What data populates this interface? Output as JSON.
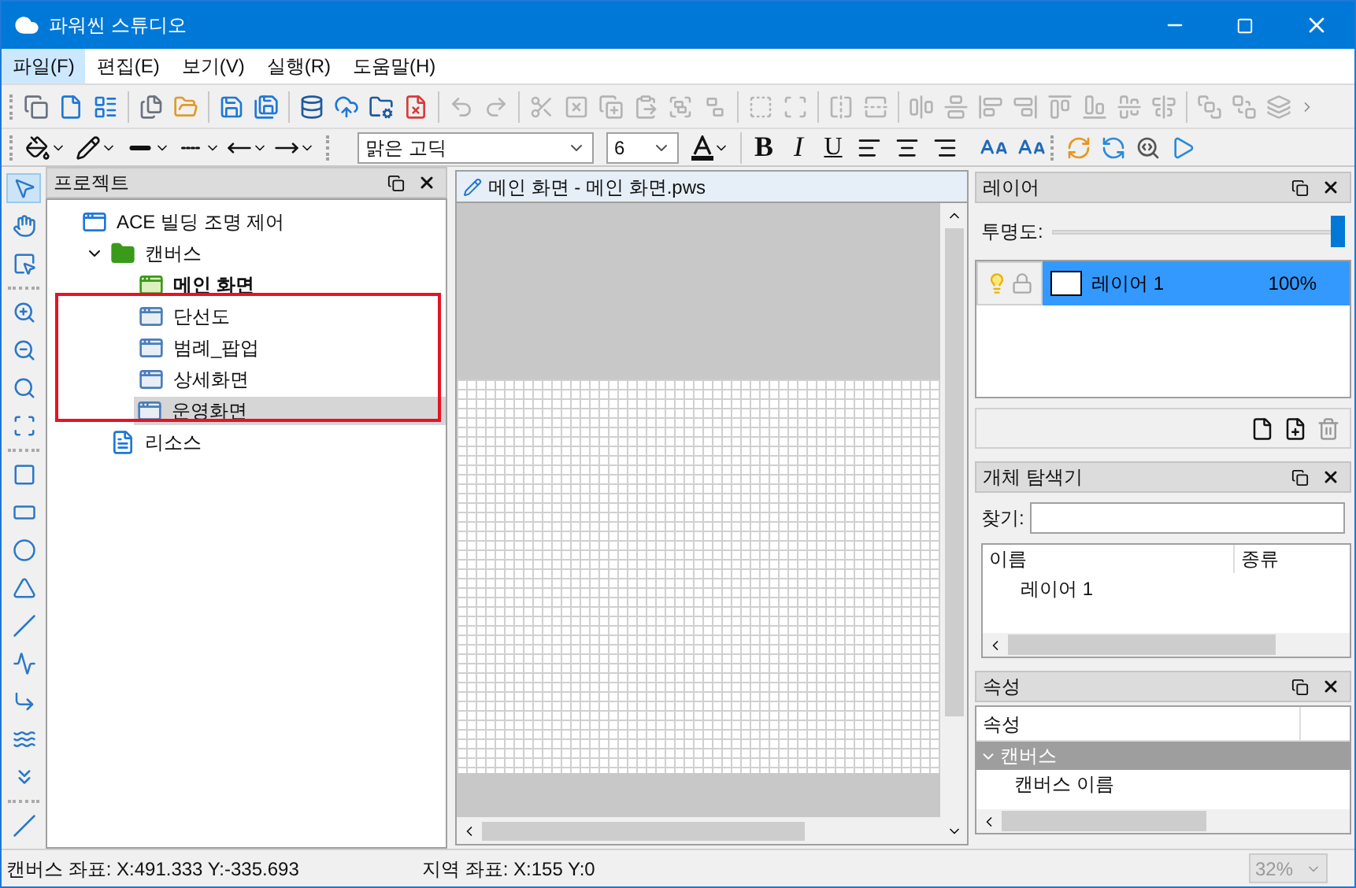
{
  "window": {
    "title": "파워씬 스튜디오"
  },
  "menu": [
    {
      "label": "파일(F)",
      "selected": true
    },
    {
      "label": "편집(E)",
      "selected": false
    },
    {
      "label": "보기(V)",
      "selected": false
    },
    {
      "label": "실행(R)",
      "selected": false
    },
    {
      "label": "도움말(H)",
      "selected": false
    }
  ],
  "toolbar": [
    {
      "kind": "button",
      "disabled": false
    },
    {
      "kind": "button",
      "disabled": false
    },
    {
      "kind": "button",
      "disabled": false
    },
    {
      "kind": "separator"
    },
    {
      "kind": "button",
      "disabled": false
    },
    {
      "kind": "button",
      "disabled": false
    },
    {
      "kind": "separator"
    },
    {
      "kind": "button",
      "disabled": false
    },
    {
      "kind": "button",
      "disabled": false
    },
    {
      "kind": "separator"
    },
    {
      "kind": "button",
      "disabled": false
    },
    {
      "kind": "button",
      "disabled": false
    },
    {
      "kind": "button",
      "disabled": false
    },
    {
      "kind": "button",
      "disabled": false
    },
    {
      "kind": "separator"
    },
    {
      "kind": "button",
      "disabled": true
    },
    {
      "kind": "button",
      "disabled": true
    },
    {
      "kind": "separator"
    },
    {
      "kind": "button",
      "disabled": true
    },
    {
      "kind": "button",
      "disabled": true
    },
    {
      "kind": "button",
      "disabled": true
    },
    {
      "kind": "button",
      "disabled": true
    },
    {
      "kind": "button",
      "disabled": true
    },
    {
      "kind": "button",
      "disabled": true
    },
    {
      "kind": "separator"
    },
    {
      "kind": "button",
      "disabled": true
    },
    {
      "kind": "button",
      "disabled": true
    },
    {
      "kind": "separator"
    },
    {
      "kind": "button",
      "disabled": true
    },
    {
      "kind": "button",
      "disabled": true
    },
    {
      "kind": "separator"
    },
    {
      "kind": "button",
      "disabled": true
    },
    {
      "kind": "button",
      "disabled": true
    },
    {
      "kind": "button",
      "disabled": true
    },
    {
      "kind": "button",
      "disabled": true
    },
    {
      "kind": "button",
      "disabled": true
    },
    {
      "kind": "button",
      "disabled": true
    },
    {
      "kind": "button",
      "disabled": true
    },
    {
      "kind": "button",
      "disabled": true
    },
    {
      "kind": "separator"
    },
    {
      "kind": "button",
      "disabled": true
    },
    {
      "kind": "button",
      "disabled": true
    },
    {
      "kind": "button",
      "disabled": true
    }
  ],
  "format_bar": {
    "font": "맑은 고딕",
    "size": "6",
    "bold": "B",
    "italic": "I",
    "underline": "U"
  },
  "project": {
    "title": "프로젝트",
    "tree": [
      {
        "label": "ACE 빌딩 조명 제어",
        "kind": "project",
        "children": [
          {
            "label": "캔버스",
            "kind": "folder",
            "expanded": true,
            "children": [
              {
                "label": "메인 화면",
                "kind": "main-canvas",
                "selected": false
              },
              {
                "label": "단선도",
                "kind": "canvas",
                "selected": false
              },
              {
                "label": "범례_팝업",
                "kind": "canvas",
                "selected": false
              },
              {
                "label": "상세화면",
                "kind": "canvas",
                "selected": false
              },
              {
                "label": "운영화면",
                "kind": "canvas",
                "selected": true
              }
            ]
          },
          {
            "label": "리소스",
            "kind": "resource"
          }
        ]
      }
    ]
  },
  "document": {
    "tab": "메인 화면 - 메인 화면.pws"
  },
  "layers": {
    "title": "레이어",
    "opacity_label": "투명도:",
    "opacity": {
      "level": 1
    },
    "items": [
      {
        "name": "레이어 1",
        "opacity": "100%",
        "visible": true,
        "locked": false,
        "selected": true
      }
    ]
  },
  "object_explorer": {
    "title": "개체 탐색기",
    "find_label": "찾기:",
    "columns": [
      "이름",
      "종류"
    ],
    "rows": [
      "레이어 1"
    ]
  },
  "properties": {
    "title": "속성",
    "header": "속성",
    "categories": [
      {
        "label": "캔버스",
        "expanded": true,
        "rows": [
          "캔버스 이름"
        ]
      }
    ]
  },
  "status_bar": {
    "canvas_coords": "캔버스 좌표: X:491.333 Y:-335.693",
    "region_coords": "지역 좌표: X:155 Y:0",
    "zoom": "32%",
    "zoom_disabled": true
  }
}
